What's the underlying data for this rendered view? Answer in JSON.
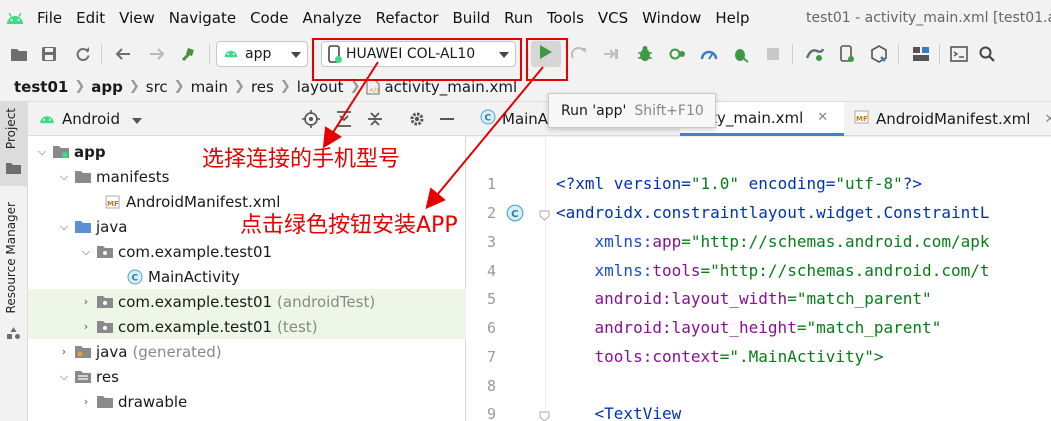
{
  "menubar": {
    "items": [
      "File",
      "Edit",
      "View",
      "Navigate",
      "Code",
      "Analyze",
      "Refactor",
      "Build",
      "Run",
      "Tools",
      "VCS",
      "Window",
      "Help"
    ],
    "window_title": "test01 - activity_main.xml [test01.a"
  },
  "toolbar": {
    "config_combo": "app",
    "device_combo": "HUAWEI COL-AL10",
    "icons": [
      "open-folder-icon",
      "save-icon",
      "sync-icon",
      "back-icon",
      "forward-icon",
      "build-hammer-icon",
      "run-icon",
      "apply-changes-icon",
      "debug-icon",
      "profile-icon",
      "attach-debugger-icon",
      "stop-icon",
      "gradle-sync-icon",
      "device-manager-icon",
      "sdk-manager-icon",
      "project-structure-icon",
      "terminal-icon",
      "search-icon"
    ]
  },
  "breadcrumb": [
    "test01",
    "app",
    "src",
    "main",
    "res",
    "layout",
    "activity_main.xml"
  ],
  "side_strip": {
    "tabs": [
      "Project",
      "Resource Manager"
    ]
  },
  "project_panel": {
    "view_selector": "Android",
    "tree": [
      {
        "label": "app",
        "muted": ""
      },
      {
        "label": "manifests",
        "muted": ""
      },
      {
        "label": "AndroidManifest.xml",
        "muted": ""
      },
      {
        "label": "java",
        "muted": ""
      },
      {
        "label": "com.example.test01",
        "muted": ""
      },
      {
        "label": "MainActivity",
        "muted": ""
      },
      {
        "label": "com.example.test01",
        "muted": "(androidTest)"
      },
      {
        "label": "com.example.test01",
        "muted": "(test)"
      },
      {
        "label": "java",
        "muted": "(generated)"
      },
      {
        "label": "res",
        "muted": ""
      },
      {
        "label": "drawable",
        "muted": ""
      }
    ]
  },
  "editor": {
    "tabs": [
      {
        "label": "MainA",
        "badge": "C"
      },
      {
        "label": "tivity_main.xml",
        "badge": ""
      },
      {
        "label": "AndroidManifest.xml",
        "badge": "MF"
      }
    ],
    "line_numbers": [
      "1",
      "2",
      "3",
      "4",
      "5",
      "6",
      "7",
      "8",
      "9"
    ],
    "code": {
      "l1_a": "<?xml version=",
      "l1_b": "\"1.0\"",
      "l1_c": " encoding=",
      "l1_d": "\"utf-8\"",
      "l1_e": "?>",
      "l2": "<androidx.constraintlayout.widget.ConstraintL",
      "l3_ns": "    xmlns:",
      "l3_attr": "app",
      "l3_val": "=\"http://schemas.android.com/apk",
      "l4_ns": "    xmlns:",
      "l4_attr": "tools",
      "l4_val": "=\"http://schemas.android.com/t",
      "l5_ns": "    android:",
      "l5_attr": "layout_width",
      "l5_val": "=\"match_parent\"",
      "l6_ns": "    android:",
      "l6_attr": "layout_height",
      "l6_val": "=\"match_parent\"",
      "l7_ns": "    tools:",
      "l7_attr": "context",
      "l7_val": "=\".MainActivity\">",
      "l9": "    <TextView"
    }
  },
  "tooltip": {
    "label": "Run 'app'",
    "shortcut": "Shift+F10"
  },
  "annotations": {
    "select_device": "选择连接的手机型号",
    "click_run": "点击绿色按钮安装APP"
  },
  "colors": {
    "accent_red": "#e60000",
    "run_green": "#3c9a43",
    "android_green": "#3ddc84"
  }
}
